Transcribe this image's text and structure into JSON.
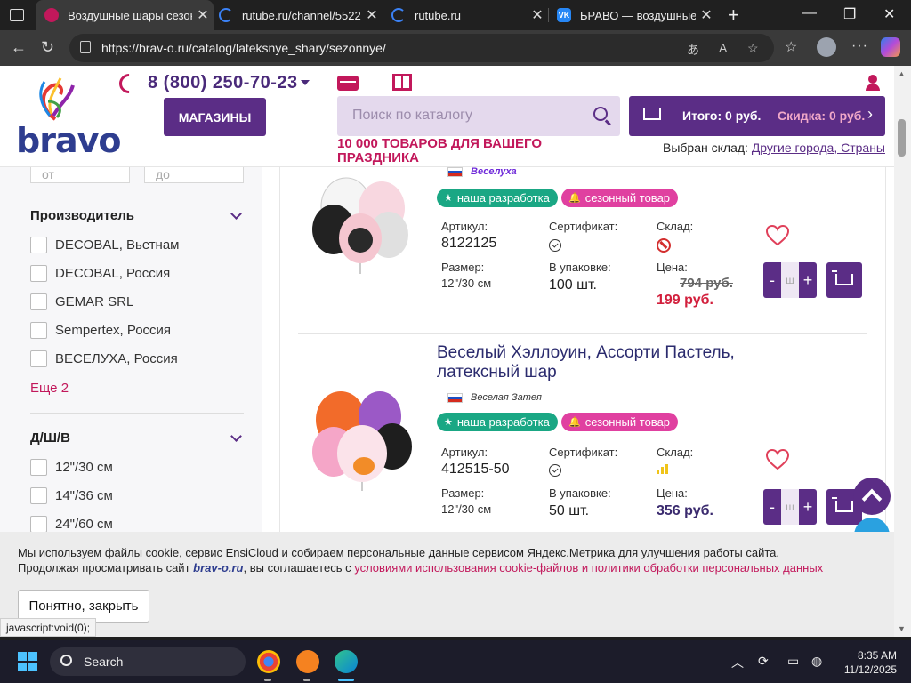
{
  "browser": {
    "tabs": [
      {
        "label": "Воздушные шары сезон",
        "active": true,
        "favicon_color": "#c2185b"
      },
      {
        "label": "rutube.ru/channel/55223",
        "active": false,
        "favicon_color": "#3b82f6"
      },
      {
        "label": "rutube.ru",
        "active": false,
        "favicon_color": "#3b82f6"
      },
      {
        "label": "БРАВО — воздушные ш",
        "active": false,
        "favicon_color": "#2787f5"
      }
    ],
    "url": "https://brav-o.ru/catalog/lateksnye_shary/sezonnye/",
    "status_url": "javascript:void(0);"
  },
  "header": {
    "logo_text": "bravo",
    "phone": "8 (800) 250-70-23",
    "shops_button": "МАГАЗИНЫ",
    "search_placeholder": "Поиск по каталогу",
    "slogan": "10 000 ТОВАРОВ ДЛЯ ВАШЕГО ПРАЗДНИКА",
    "cart_total": "Итого: 0 руб.",
    "cart_discount": "Скидка: 0 руб.",
    "warehouse_label": "Выбран склад:",
    "warehouse_link": "Другие города, Страны"
  },
  "sidebar": {
    "range_from": "от",
    "range_to": "до",
    "manufacturer_title": "Производитель",
    "manufacturers": [
      "DECOBAL, Вьетнам",
      "DECOBAL, Россия",
      "GEMAR SRL",
      "Sempertex, Россия",
      "ВЕСЕЛУХА, Россия"
    ],
    "more_link": "Еще 2",
    "size_title": "Д/Ш/В",
    "sizes": [
      "12\"/30 см",
      "14\"/36 см",
      "24\"/60 см"
    ]
  },
  "labels": {
    "article": "Артикул:",
    "certificate": "Сертификат:",
    "warehouse": "Склад:",
    "size": "Размер:",
    "pack": "В упаковке:",
    "price": "Цена:",
    "badge_own": "наша разработка",
    "badge_season": "сезонный товар",
    "qty_minus": "-",
    "qty_placeholder": "ш",
    "qty_plus": "+"
  },
  "products": [
    {
      "title": "",
      "brand_mark": "Веселуха",
      "article": "8122125",
      "size": "12\"/30 см",
      "pack": "100 шт.",
      "in_stock": false,
      "old_price": "794 руб.",
      "price": "199 руб."
    },
    {
      "title": "Веселый Хэллоуин, Ассорти Пастель, латексный шар",
      "brand_mark": "Веселая Затея",
      "article": "412515-50",
      "size": "12\"/30 см",
      "pack": "50 шт.",
      "in_stock": true,
      "old_price": "",
      "price": "356 руб."
    }
  ],
  "cookie": {
    "line1": "Мы используем файлы cookie, сервис EnsiCloud и собираем персональные данные сервисом Яндекс.Метрика для улучшения работы сайта.",
    "line2_prefix": "Продолжая просматривать сайт ",
    "line2_brand": "brav-o.ru",
    "line2_mid": ", вы соглашаетесь с ",
    "line2_link": "условиями использования cookie-файлов и политики обработки персональных данных",
    "button": "Понятно, закрыть"
  },
  "taskbar": {
    "search_label": "Search",
    "time": "8:35 AM",
    "date": "11/12/2025"
  },
  "colors": {
    "brand_purple": "#5b2d86",
    "brand_pink": "#c2185b",
    "badge_own": "#1aa784",
    "badge_season": "#e040a0",
    "price_red": "#d21f3c"
  }
}
